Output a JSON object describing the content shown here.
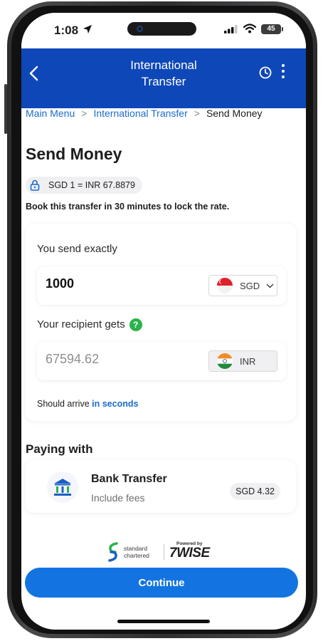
{
  "status_bar": {
    "time": "1:08",
    "battery": "45"
  },
  "header": {
    "title_line1": "International",
    "title_line2": "Transfer"
  },
  "breadcrumb": {
    "items": [
      "Main Menu",
      "International Transfer"
    ],
    "current": "Send Money",
    "separator": ">"
  },
  "page": {
    "title": "Send Money",
    "rate": "SGD 1 = INR 67.8879",
    "lock_note": "Book this transfer in 30 minutes to lock the rate."
  },
  "send": {
    "label": "You send exactly",
    "amount": "1000",
    "currency": "SGD",
    "recipient_label": "Your recipient gets",
    "recipient_amount": "67594.62",
    "recipient_currency": "INR",
    "help_glyph": "?",
    "arrive_prefix": "Should arrive",
    "arrive_time": "in seconds"
  },
  "paying": {
    "heading": "Paying with",
    "method": "Bank Transfer",
    "subtitle": "Include fees",
    "fee": "SGD 4.32"
  },
  "partners": {
    "bank_line1": "standard",
    "bank_line2": "chartered",
    "powered_by": "Powered by",
    "wise": "7WISE"
  },
  "actions": {
    "continue": "Continue"
  },
  "colors": {
    "header": "#0e47b8",
    "primary_button": "#1374e1",
    "link": "#1b6bc9",
    "help_badge": "#2bb24c"
  },
  "icons": [
    "back-chevron-icon",
    "history-clock-icon",
    "more-vertical-icon",
    "lock-icon",
    "chevron-down-icon",
    "help-icon",
    "bank-icon",
    "standard-chartered-logo",
    "singapore-flag",
    "india-flag"
  ]
}
